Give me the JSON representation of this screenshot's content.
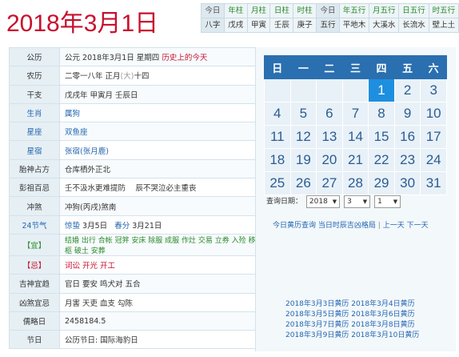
{
  "title": {
    "year": "2018",
    "nian": "年",
    "month": "3",
    "yue": "月",
    "day": "1",
    "ri": "日"
  },
  "pillars": {
    "top": [
      "今日",
      "年柱",
      "月柱",
      "日柱",
      "时柱",
      "今日",
      "年五行",
      "月五行",
      "日五行",
      "时五行"
    ],
    "bottom": [
      "八字",
      "戊戌",
      "甲寅",
      "壬辰",
      "庚子",
      "五行",
      "平地木",
      "大溪水",
      "长流水",
      "壁上土"
    ]
  },
  "info": {
    "gongli_label": "公历",
    "gongli_value": "公元 2018年3月1日 星期四",
    "gongli_link": "历史上的今天",
    "nongli_label": "农历",
    "nongli_value": "二零一八年 正月",
    "nongli_big": "(大)",
    "nongli_day": "十四",
    "ganzhi_label": "干支",
    "ganzhi_value": "戊戌年 甲寅月 壬辰日",
    "shengxiao_label": "生肖",
    "shengxiao_value": "属狗",
    "xingzuo_label": "星座",
    "xingzuo_value": "双鱼座",
    "xingxiu_label": "星宿",
    "xingxiu_value": "张宿(张月鹿)",
    "taishen_label": "胎神占方",
    "taishen_value": "仓库栖外正北",
    "pengzu_label": "彭祖百忌",
    "pengzu_value": "壬不汲水更难提防　 辰不哭泣必主重丧",
    "chongsha_label": "冲煞",
    "chongsha_value": "冲狗(丙戌)煞南",
    "jieqi_label": "24节气",
    "jieqi_a": "惊蛰",
    "jieqi_a_date": "3月5日",
    "jieqi_b": "春分",
    "jieqi_b_date": "3月21日",
    "yi_label": "【宜】",
    "yi_value": "结婚 出行 合帐 冠笄 安床 除服 成服 作灶 交易 立券 入殓 移柩 破土 安葬",
    "ji_label": "【忌】",
    "ji_value": "词讼 开光 开工",
    "jishen_label": "吉神宜趋",
    "jishen_value": "官日 要安 鸣犬对 五合",
    "xiongsha_label": "凶煞宜忌",
    "xiongsha_value": "月害 天吏 血支 勾陈",
    "rulue_label": "儒略日",
    "rulue_value": "2458184.5",
    "jieri_label": "节日",
    "jieri_value": "公历节日: 国际海豹日"
  },
  "calendar": {
    "weekdays": [
      "日",
      "一",
      "二",
      "三",
      "四",
      "五",
      "六"
    ],
    "weeks": [
      [
        "",
        "",
        "",
        "",
        "1",
        "2",
        "3"
      ],
      [
        "4",
        "5",
        "6",
        "7",
        "8",
        "9",
        "10"
      ],
      [
        "11",
        "12",
        "13",
        "14",
        "15",
        "16",
        "17"
      ],
      [
        "18",
        "19",
        "20",
        "21",
        "22",
        "23",
        "24"
      ],
      [
        "25",
        "26",
        "27",
        "28",
        "29",
        "30",
        "31"
      ]
    ],
    "selected_day": "1"
  },
  "query": {
    "label": "查询日期：",
    "year": "2018",
    "month": "3",
    "day": "1"
  },
  "links": {
    "today": "今日黄历查询",
    "shichen": "当日时辰吉凶格局",
    "sep": "|",
    "prev": "上一天",
    "next": "下一天"
  },
  "history_links": [
    "2018年3月3日黄历",
    "2018年3月4日黄历",
    "2018年3月5日黄历",
    "2018年3月6日黄历",
    "2018年3月7日黄历",
    "2018年3月8日黄历",
    "2018年3月9日黄历",
    "2018年3月10日黄历"
  ],
  "colors": {
    "accent_red": "#c8102e",
    "calendar_header": "#2a6fb0",
    "selected_day": "#1e8fdf",
    "link_blue": "#2466b0",
    "green": "#2b8a2b"
  }
}
